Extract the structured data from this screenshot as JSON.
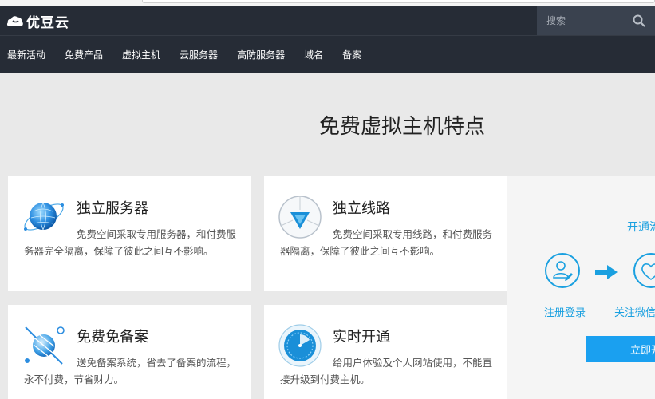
{
  "header": {
    "logo_text": "优豆云",
    "search_placeholder": "搜索"
  },
  "nav": {
    "items": [
      "最新活动",
      "免费产品",
      "虚拟主机",
      "云服务器",
      "高防服务器",
      "域名",
      "备案"
    ]
  },
  "main": {
    "section_title": "免费虚拟主机特点",
    "features": [
      {
        "title": "独立服务器",
        "desc": "免费空间采取专用服务器，和付费服务器完全隔离，保障了彼此之间互不影响。",
        "icon": "globe-icon"
      },
      {
        "title": "独立线路",
        "desc": "免费空间采取专用线路，和付费服务器隔离，保障了彼此之间互不影响。",
        "icon": "route-icon"
      },
      {
        "title": "免费免备案",
        "desc": "送免备案系统，省去了备案的流程，永不付费，节省财力。",
        "icon": "satellite-icon"
      },
      {
        "title": "实时开通",
        "desc": "给用户体验及个人网站使用，不能直接升级到付费主机。",
        "icon": "clock-icon"
      }
    ]
  },
  "side": {
    "heading": "开通流程",
    "step_register": "注册登录",
    "step_follow": "关注微信",
    "open_button": "立即开通"
  },
  "colors": {
    "header_bg": "#262c36",
    "accent": "#1aa0e0",
    "button_bg": "#1aa0f0"
  }
}
